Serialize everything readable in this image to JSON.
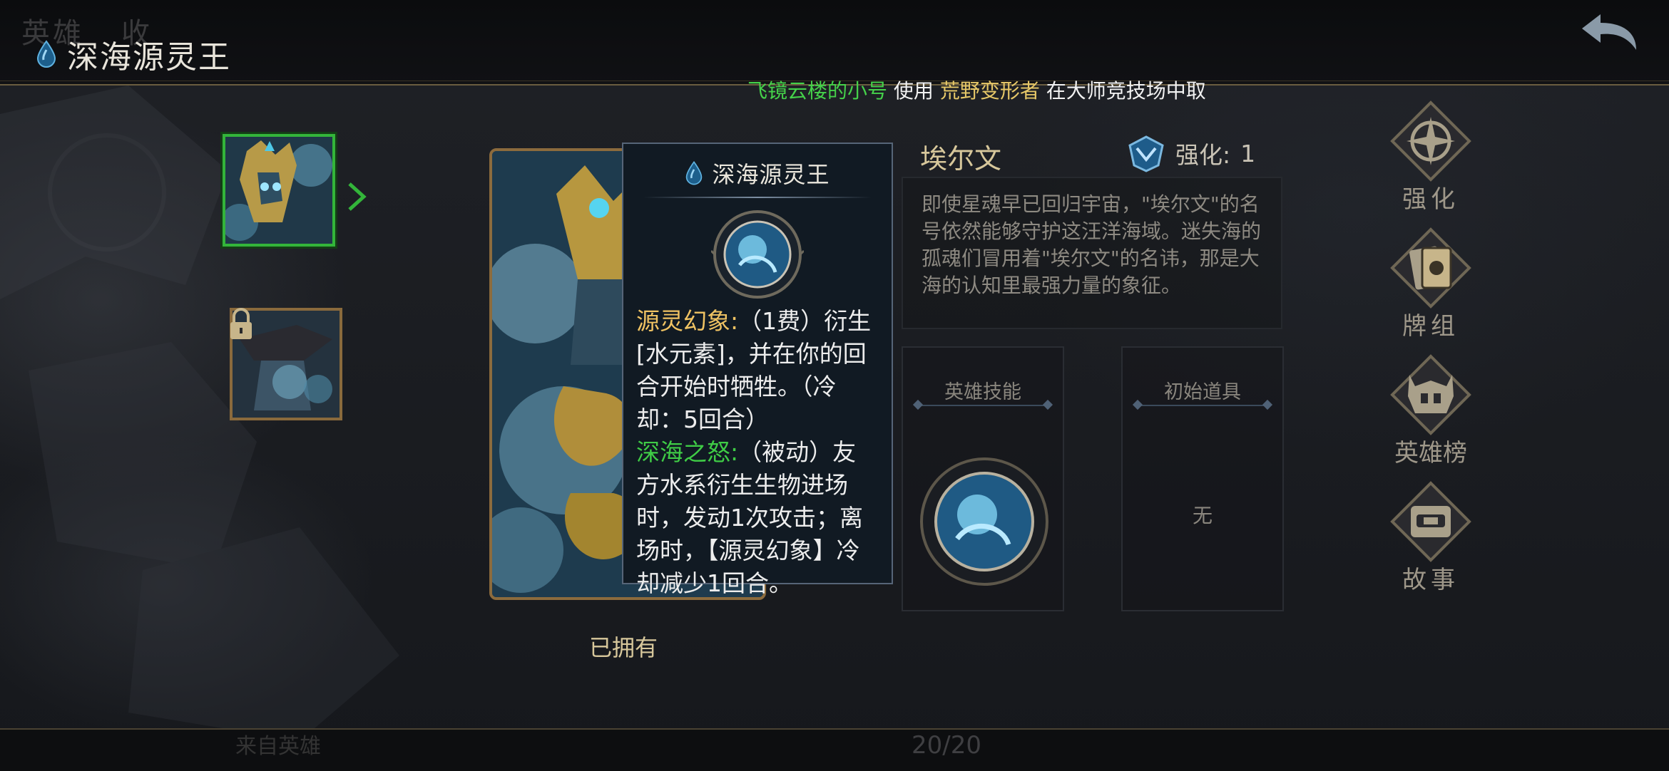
{
  "header": {
    "ghost_nav_1": "英雄",
    "ghost_nav_2": "收",
    "title": "深海源灵王"
  },
  "ticker": {
    "player": "飞镜云楼的小号",
    "verb": "使用",
    "hero": "荒野变形者",
    "rest": "在大师竞技场中取"
  },
  "tooltip": {
    "title": "深海源灵王",
    "skill1_name": "源灵幻象:",
    "skill1_text": "（1费）衍生[水元素]，并在你的回合开始时牺牲。（冷却：5回合）",
    "skill2_name": "深海之怒:",
    "skill2_text": "（被动）友方水系衍生生物进场时，发动1次攻击；离场时，【源灵幻象】冷却减少1回合。"
  },
  "hero": {
    "name": "埃尔文",
    "enhance_label": "强化:",
    "enhance_value": "1",
    "description": "即使星魂早已回归宇宙，\"埃尔文\"的名号依然能够守护这汪洋海域。迷失海的孤魂们冒用着\"埃尔文\"的名讳，那是大海的认知里最强力量的象征。",
    "owned_status": "已拥有"
  },
  "panels": {
    "skill_title": "英雄技能",
    "item_title": "初始道具",
    "item_value": "无"
  },
  "side_menu": [
    {
      "label": "强化",
      "icon": "enhance-compass-icon"
    },
    {
      "label": "牌组",
      "icon": "deck-cards-icon"
    },
    {
      "label": "英雄榜",
      "icon": "helmet-icon"
    },
    {
      "label": "故事",
      "icon": "story-scroll-icon"
    }
  ],
  "footer": {
    "page_counter": "20/20",
    "ghost_label": "来自英雄"
  },
  "colors": {
    "accent_gold": "#d7c79b",
    "skill_yellow": "#f0c363",
    "skill_green": "#3fcc46",
    "active_border": "#33b53a"
  }
}
